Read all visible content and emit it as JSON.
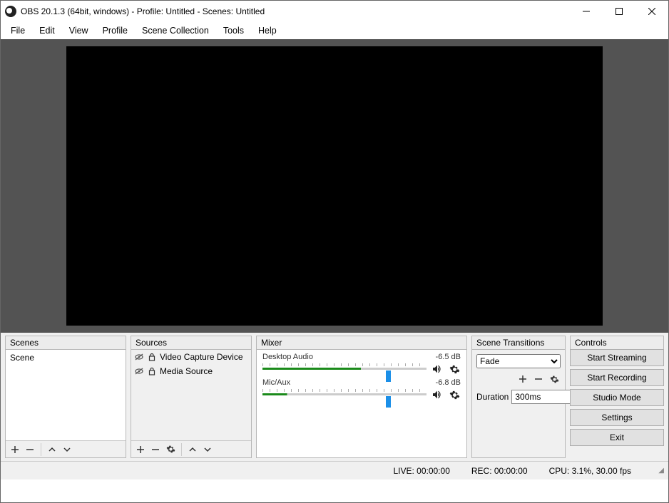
{
  "titlebar": {
    "title": "OBS 20.1.3 (64bit, windows) - Profile: Untitled - Scenes: Untitled"
  },
  "menubar": {
    "items": [
      "File",
      "Edit",
      "View",
      "Profile",
      "Scene Collection",
      "Tools",
      "Help"
    ]
  },
  "panels": {
    "scenes": {
      "label": "Scenes",
      "items": [
        {
          "name": "Scene"
        }
      ]
    },
    "sources": {
      "label": "Sources",
      "items": [
        {
          "name": "Video Capture Device",
          "visible": false,
          "locked": true
        },
        {
          "name": "Media Source",
          "visible": false,
          "locked": true
        }
      ]
    },
    "mixer": {
      "label": "Mixer",
      "channels": [
        {
          "name": "Desktop Audio",
          "level_db": "-6.5 dB",
          "slider_pct": 75,
          "bar_pct": 60
        },
        {
          "name": "Mic/Aux",
          "level_db": "-6.8 dB",
          "slider_pct": 75,
          "bar_pct": 15
        }
      ]
    },
    "transitions": {
      "label": "Scene Transitions",
      "selected": "Fade",
      "duration_label": "Duration",
      "duration_value": "300ms"
    },
    "controls": {
      "label": "Controls",
      "buttons": {
        "start_streaming": "Start Streaming",
        "start_recording": "Start Recording",
        "studio_mode": "Studio Mode",
        "settings": "Settings",
        "exit": "Exit"
      }
    }
  },
  "statusbar": {
    "live": "LIVE: 00:00:00",
    "rec": "REC: 00:00:00",
    "cpu": "CPU: 3.1%, 30.00 fps"
  }
}
